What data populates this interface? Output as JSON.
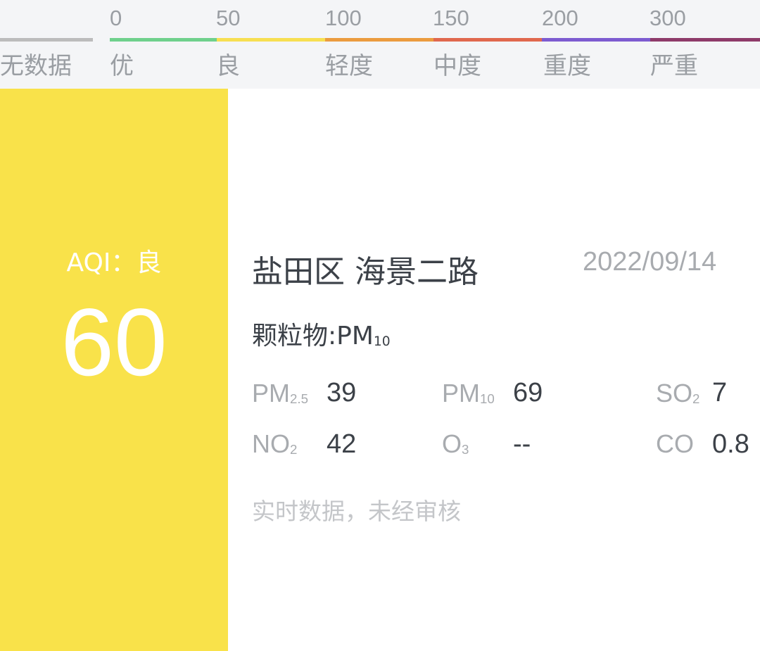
{
  "legend": {
    "no_data_label": "无数据",
    "ticks": [
      "0",
      "50",
      "100",
      "150",
      "200",
      "300"
    ],
    "levels": [
      "优",
      "良",
      "轻度",
      "中度",
      "重度",
      "严重"
    ],
    "colors": {
      "no_data": "#bcbcbc",
      "good": "#6fd08c",
      "moderate": "#f7df52",
      "light": "#eb9c3f",
      "medium": "#e0684e",
      "heavy": "#7d5bd0",
      "severe": "#8e3b6a"
    }
  },
  "aqi": {
    "label": "AQI：良",
    "value": "60",
    "panel_color": "#f9e24a"
  },
  "station": {
    "name": "盐田区 海景二路",
    "date": "2022/09/14"
  },
  "primary_pollutant": {
    "prefix": "颗粒物:PM",
    "sub": "10"
  },
  "metrics": {
    "pm25": {
      "label": "PM",
      "sub": "2.5",
      "value": "39"
    },
    "pm10": {
      "label": "PM",
      "sub": "10",
      "value": "69"
    },
    "so2": {
      "label": "SO",
      "sub": "2",
      "value": "7"
    },
    "no2": {
      "label": "NO",
      "sub": "2",
      "value": "42"
    },
    "o3": {
      "label": "O",
      "sub": "3",
      "value": "--"
    },
    "co": {
      "label": "CO",
      "sub": "",
      "value": "0.8"
    }
  },
  "note": "实时数据，未经审核"
}
